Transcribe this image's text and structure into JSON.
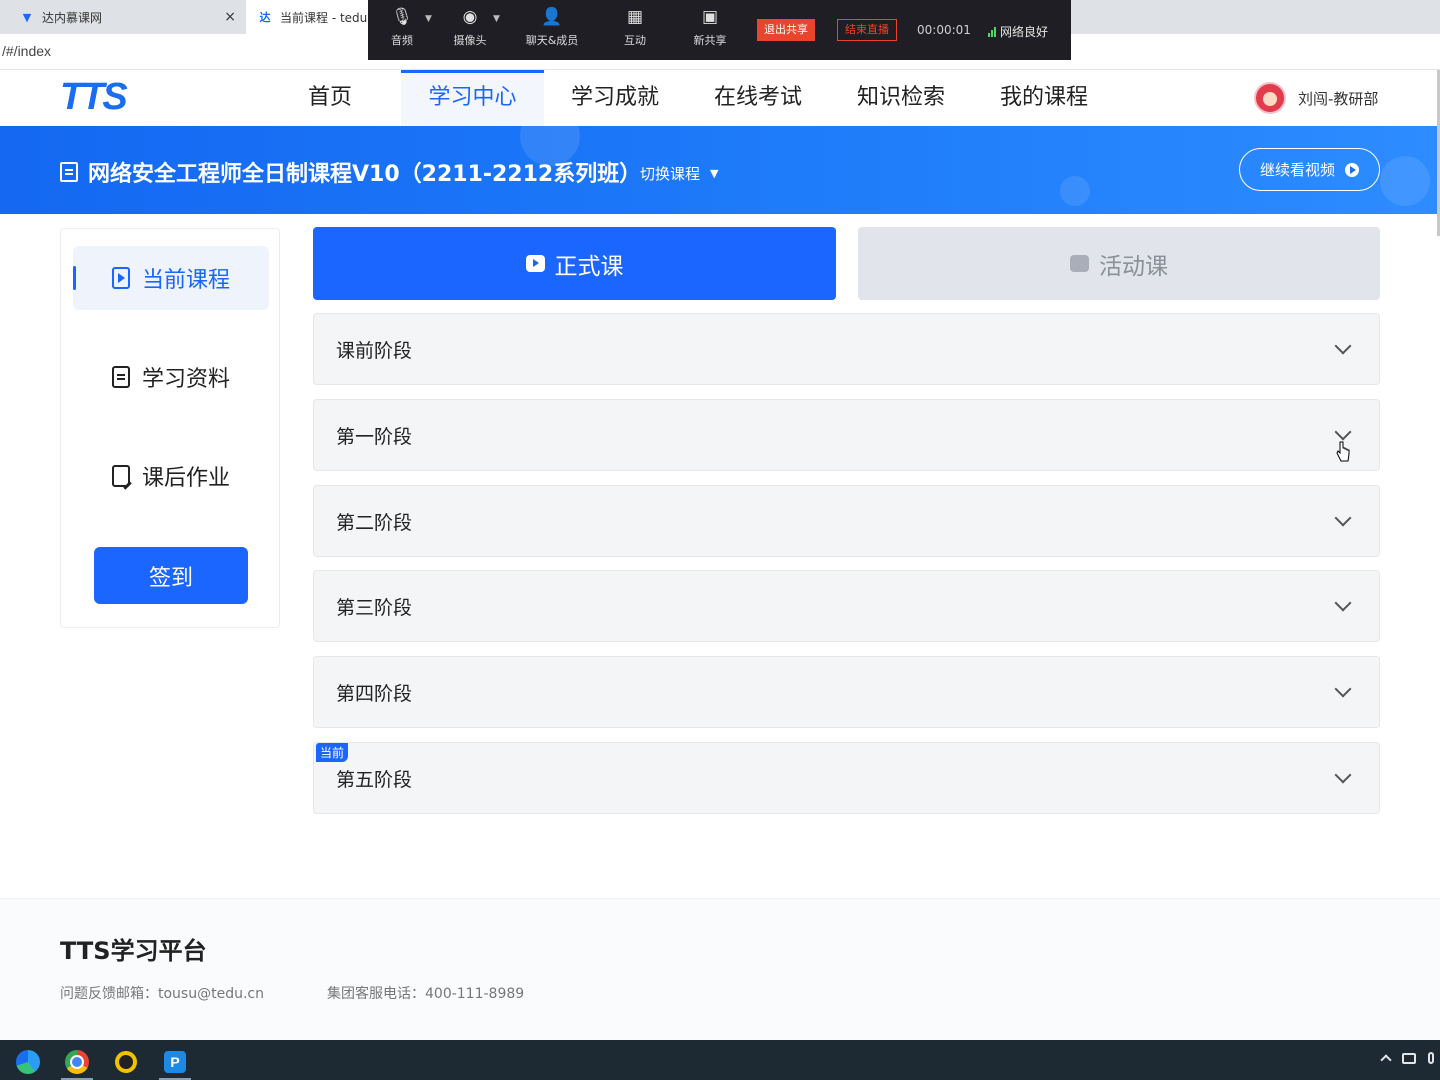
{
  "browser": {
    "tabs": [
      {
        "title": "达内慕课网",
        "close": "×"
      },
      {
        "title": "当前课程 - tedu",
        "favicon_text": "达"
      }
    ],
    "url": "/#/index"
  },
  "meeting_toolbar": {
    "audio_label": "音频",
    "camera_label": "摄像头",
    "chat_label": "聊天&成员",
    "interact_label": "互动",
    "new_share_label": "新共享",
    "stop_share": "退出共享",
    "end_live": "结束直播",
    "timer": "00:00:01",
    "network": "网络良好"
  },
  "header": {
    "logo": "TTS",
    "nav": [
      "首页",
      "学习中心",
      "学习成就",
      "在线考试",
      "知识检索",
      "我的课程"
    ],
    "active_nav": "学习中心",
    "user_name": "刘闯-教研部"
  },
  "banner": {
    "course_title": "网络安全工程师全日制课程V10（2211-2212系列班）",
    "switch_course": "切换课程",
    "continue_video": "继续看视频"
  },
  "sidebar": {
    "items": [
      "当前课程",
      "学习资料",
      "课后作业"
    ],
    "active": "当前课程",
    "signin": "签到"
  },
  "course_tabs": {
    "formal": "正式课",
    "activity": "活动课"
  },
  "stages": [
    {
      "label": "课前阶段"
    },
    {
      "label": "第一阶段"
    },
    {
      "label": "第二阶段"
    },
    {
      "label": "第三阶段"
    },
    {
      "label": "第四阶段"
    },
    {
      "label": "第五阶段",
      "badge": "当前"
    }
  ],
  "footer": {
    "title": "TTS学习平台",
    "email": "问题反馈邮箱：tousu@tedu.cn",
    "phone": "集团客服电话：400-111-8989"
  },
  "colors": {
    "primary": "#1a66ff",
    "banner_start": "#1468f2",
    "danger": "#e8452c"
  }
}
